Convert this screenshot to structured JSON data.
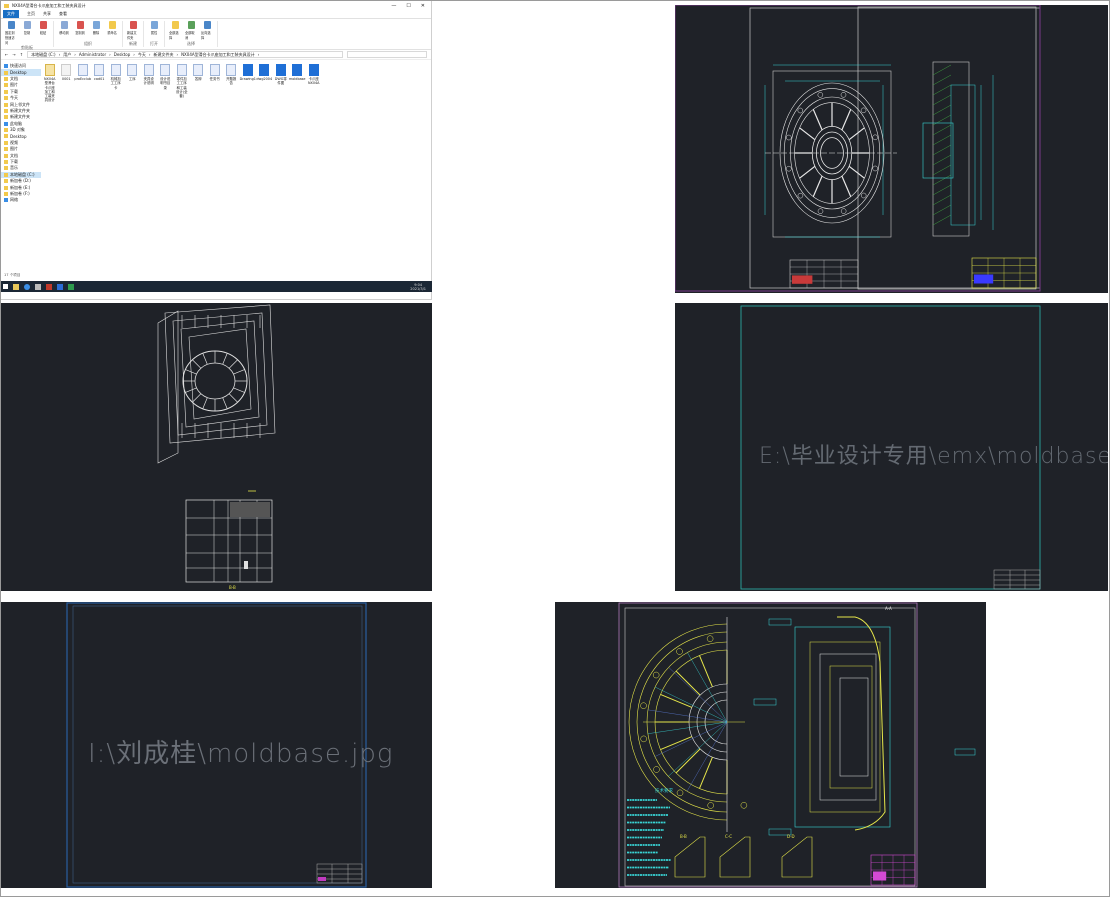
{
  "explorer": {
    "title": "NX04A型滑台卡爪座加工和工装夹具设计",
    "window_controls": [
      "—",
      "☐",
      "✕"
    ],
    "menu": [
      "文件",
      "主页",
      "共享",
      "查看"
    ],
    "ribbon_groups": [
      {
        "label": "剪贴板",
        "buttons": [
          "固定到快速访问",
          "复制",
          "粘贴"
        ]
      },
      {
        "label": "组织",
        "buttons": [
          "移动到",
          "复制到",
          "删除",
          "重命名"
        ]
      },
      {
        "label": "新建",
        "buttons": [
          "新建文件夹"
        ]
      },
      {
        "label": "打开",
        "buttons": [
          "属性"
        ]
      },
      {
        "label": "选择",
        "buttons": [
          "全部选择",
          "全部取消",
          "反向选择"
        ]
      }
    ],
    "breadcrumb": [
      "本地磁盘 (C:)",
      "用户",
      "Administrator",
      "Desktop",
      "今天",
      "新建文件夹",
      "NX04A型滑台卡爪座加工和工装夹具设计"
    ],
    "nav": [
      {
        "label": "快速访问",
        "selected": false
      },
      {
        "label": "Desktop",
        "selected": true
      },
      {
        "label": "文档",
        "selected": false
      },
      {
        "label": "图片",
        "selected": false
      },
      {
        "label": "下载",
        "selected": false
      },
      {
        "label": "今天",
        "selected": false
      },
      {
        "label": "网上邻文件",
        "selected": false
      },
      {
        "label": "新建文件夹",
        "selected": false
      },
      {
        "label": "新建文件夹",
        "selected": false
      },
      {
        "label": "此电脑",
        "selected": false
      },
      {
        "label": "3D 对象",
        "selected": false
      },
      {
        "label": "Desktop",
        "selected": false
      },
      {
        "label": "视频",
        "selected": false
      },
      {
        "label": "图片",
        "selected": false
      },
      {
        "label": "文档",
        "selected": false
      },
      {
        "label": "下载",
        "selected": false
      },
      {
        "label": "音乐",
        "selected": false
      },
      {
        "label": "本地磁盘 (C:)",
        "selected": true
      },
      {
        "label": "新加卷 (D:)",
        "selected": false
      },
      {
        "label": "新加卷 (E:)",
        "selected": false
      },
      {
        "label": "新加卷 (F:)",
        "selected": false
      },
      {
        "label": "网络",
        "selected": false
      }
    ],
    "files": [
      {
        "name": "NX04A型滑台卡爪座加工和工装夹具设计",
        "icon": "folder"
      },
      {
        "name": "0001",
        "icon": "white"
      },
      {
        "name": "proEcclub",
        "icon": "doc"
      },
      {
        "name": "cad01",
        "icon": "doc"
      },
      {
        "name": "机械加工工序卡",
        "icon": "doc"
      },
      {
        "name": "工序",
        "icon": "doc"
      },
      {
        "name": "夹具设计说明",
        "icon": "doc"
      },
      {
        "name": "设计说明书目录",
        "icon": "doc"
      },
      {
        "name": "零件加工工序和工装设计(全套)",
        "icon": "doc"
      },
      {
        "name": "答辩",
        "icon": "doc"
      },
      {
        "name": "任务书",
        "icon": "doc"
      },
      {
        "name": "开题报告",
        "icon": "doc"
      },
      {
        "name": "Drawing1",
        "icon": "dwg"
      },
      {
        "name": "dwg2004",
        "icon": "dwg"
      },
      {
        "name": "DWG零件图",
        "icon": "dwg"
      },
      {
        "name": "moldbase",
        "icon": "dwg"
      },
      {
        "name": "卡爪座 NX04A",
        "icon": "dwg"
      }
    ],
    "status": "17 个项目",
    "clock": {
      "time": "9:04",
      "date": "2021/3/1"
    }
  },
  "cad": {
    "moldbase_text_1": "E:\\毕业设计专用\\emx\\moldbase.jpg",
    "moldbase_text_2": "I:\\刘成桂\\moldbase.jpg",
    "section_labels": [
      "A-A",
      "B-B",
      "C-C",
      "D-D"
    ],
    "technical_requirements_title": "技术要求"
  },
  "colors": {
    "cad_background": "#1f2228",
    "cyan": "#39d5d5",
    "yellow": "#e6e64a",
    "magenta": "#d44ad4",
    "blue": "#3a3aff",
    "white": "#e8e8e8",
    "explorer_accent": "#1a6fc4",
    "taskbar": "#1b2735"
  }
}
